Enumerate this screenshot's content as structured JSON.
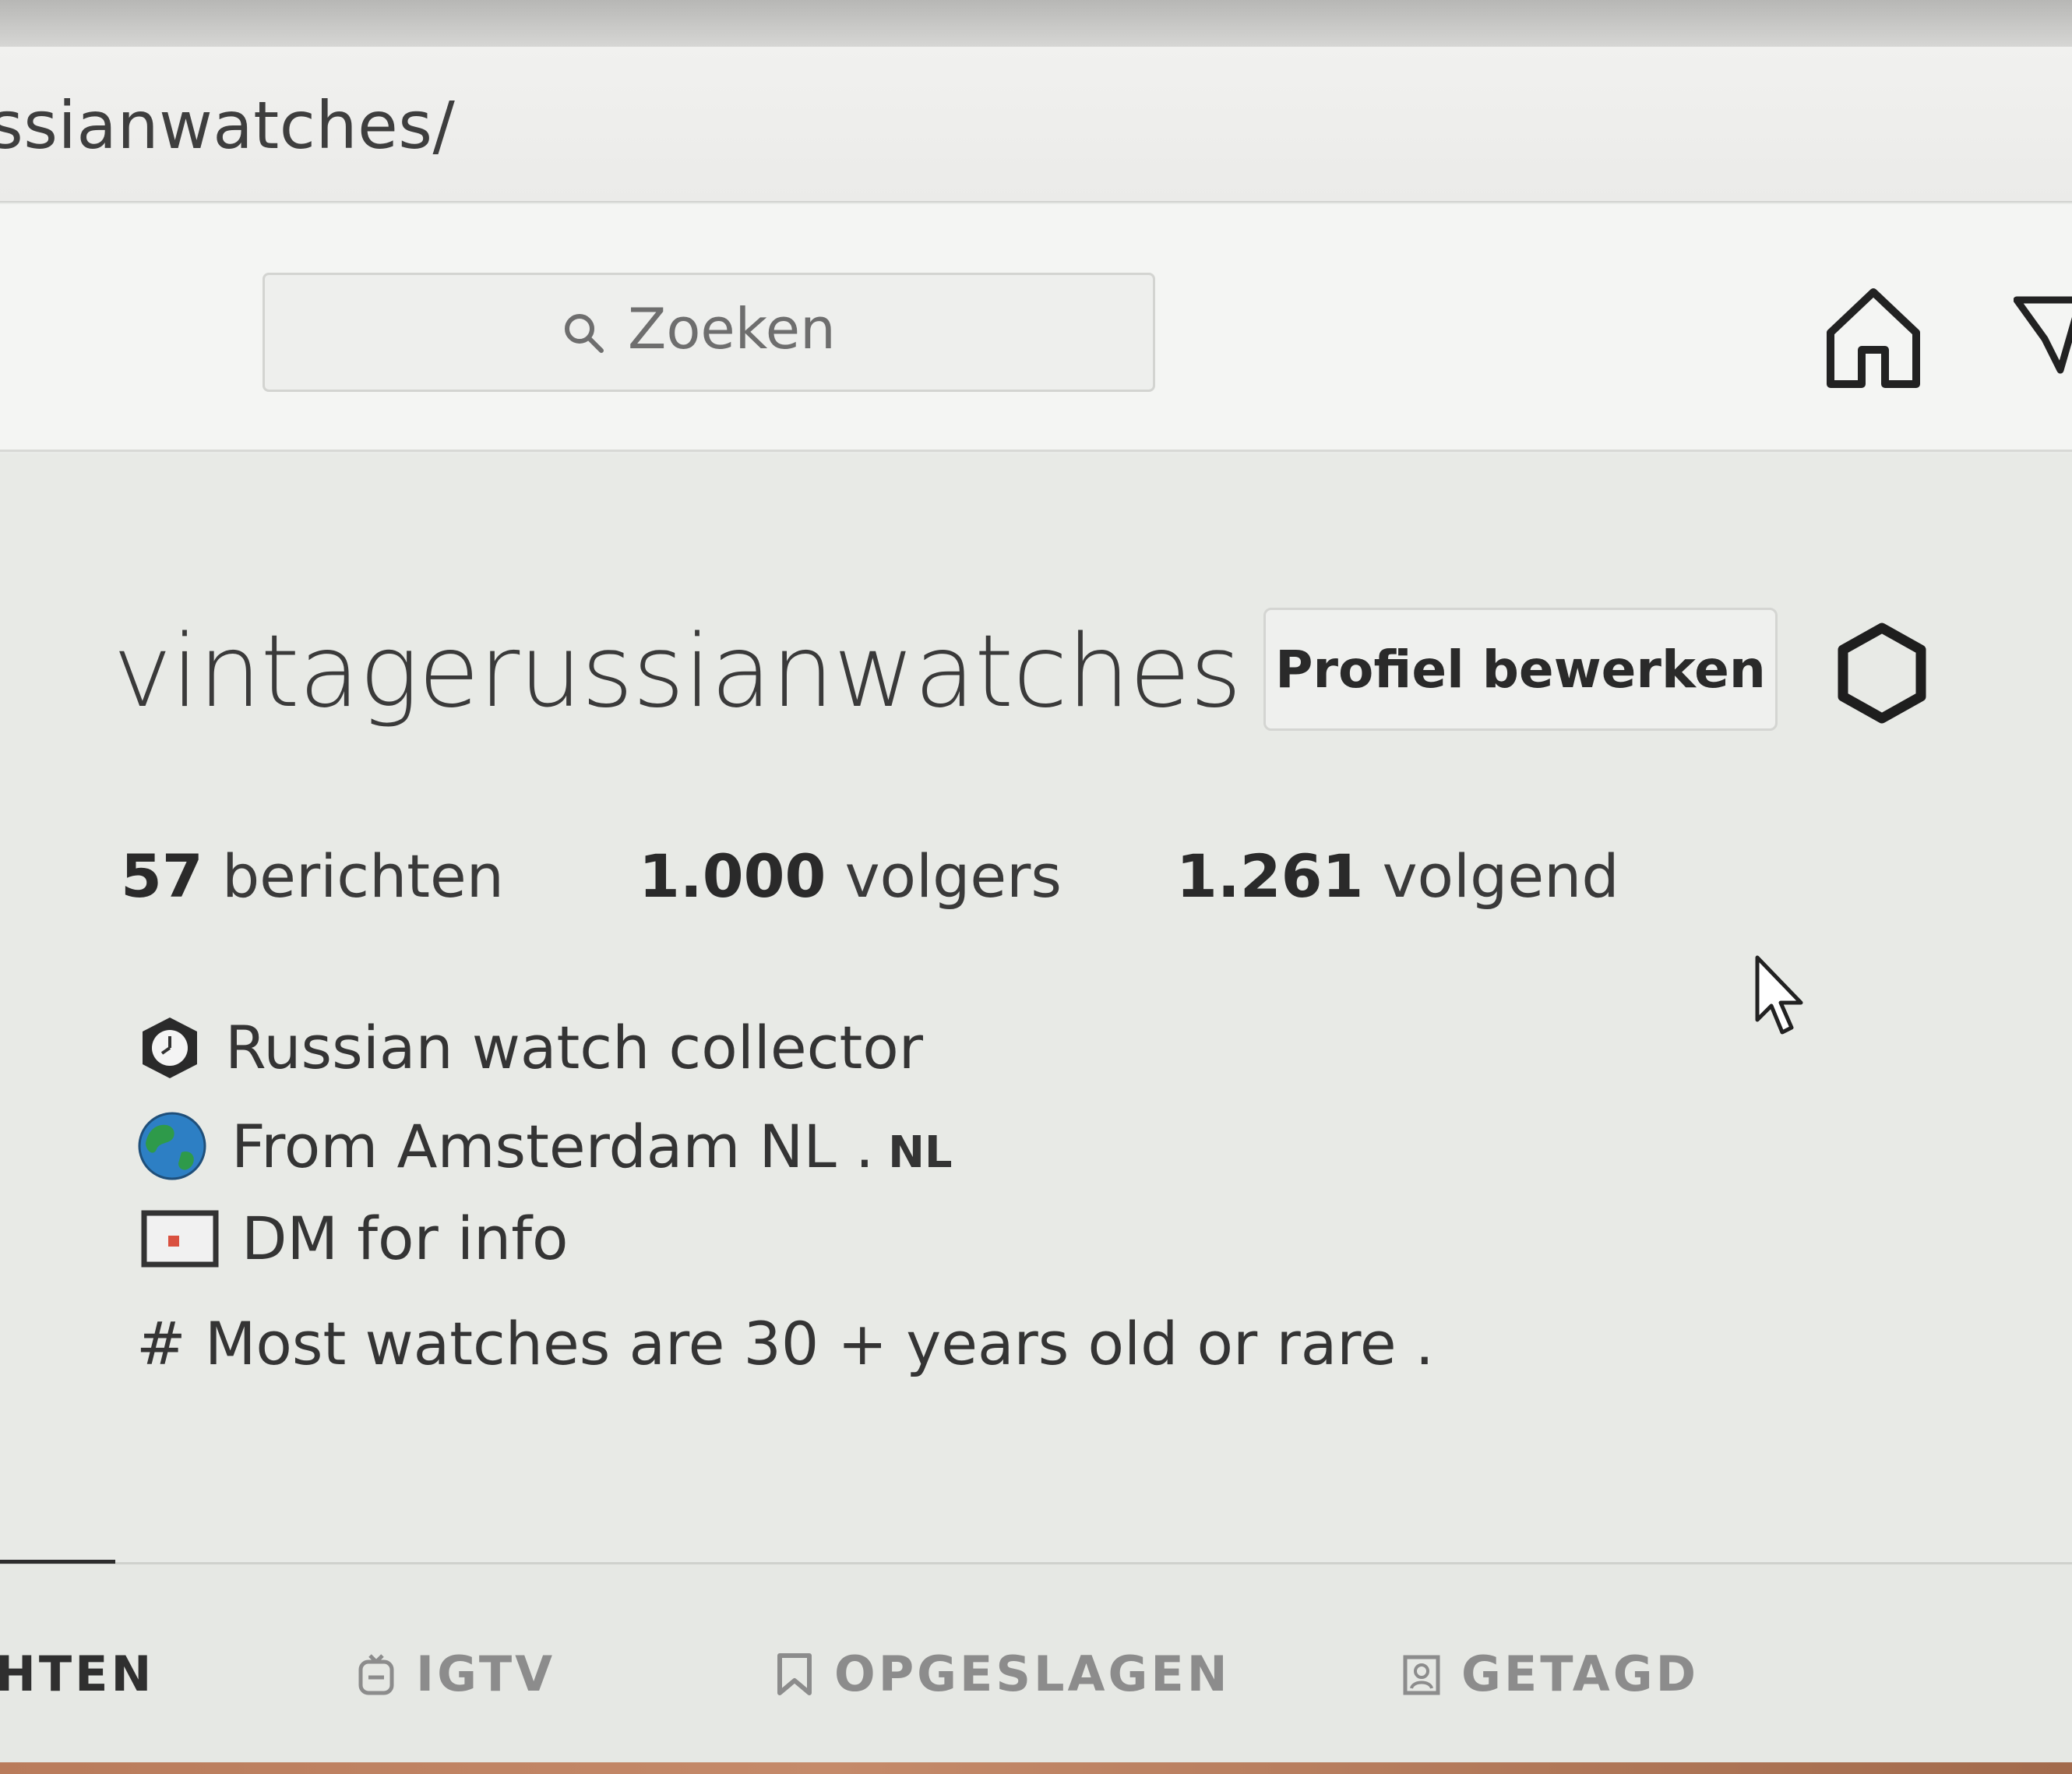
{
  "browser": {
    "address_text": "ssianwatches/"
  },
  "header": {
    "search_placeholder": "Zoeken",
    "icons": [
      "search-icon",
      "home-icon",
      "direct-icon"
    ]
  },
  "profile": {
    "username": "vintagerussianwatches",
    "edit_button_label": "Profiel bewerken",
    "stats": {
      "posts_count": "57",
      "posts_label": "berichten",
      "followers_count": "1.000",
      "followers_label": "volgers",
      "following_count": "1.261",
      "following_label": "volgend"
    },
    "bio": {
      "line1": "Russian watch collector",
      "line2": "From Amsterdam NL .",
      "line2_suffix": "NL",
      "line3": "DM for info",
      "line4": "# Most watches are 30 + years old or rare ."
    }
  },
  "tabs": [
    {
      "label": "HTEN",
      "icon": "grid-icon",
      "active": true
    },
    {
      "label": "IGTV",
      "icon": "igtv-icon",
      "active": false
    },
    {
      "label": "OPGESLAGEN",
      "icon": "bookmark-icon",
      "active": false
    },
    {
      "label": "GETAGD",
      "icon": "tag-icon",
      "active": false
    }
  ],
  "colors": {
    "page_background": "#e8eae6",
    "text": "#2f2f2f",
    "inactive_tab": "#8c8c8c",
    "globe_blue": "#2d7fc4",
    "globe_green": "#2e9a4a",
    "mail_accent": "#d9503f"
  }
}
